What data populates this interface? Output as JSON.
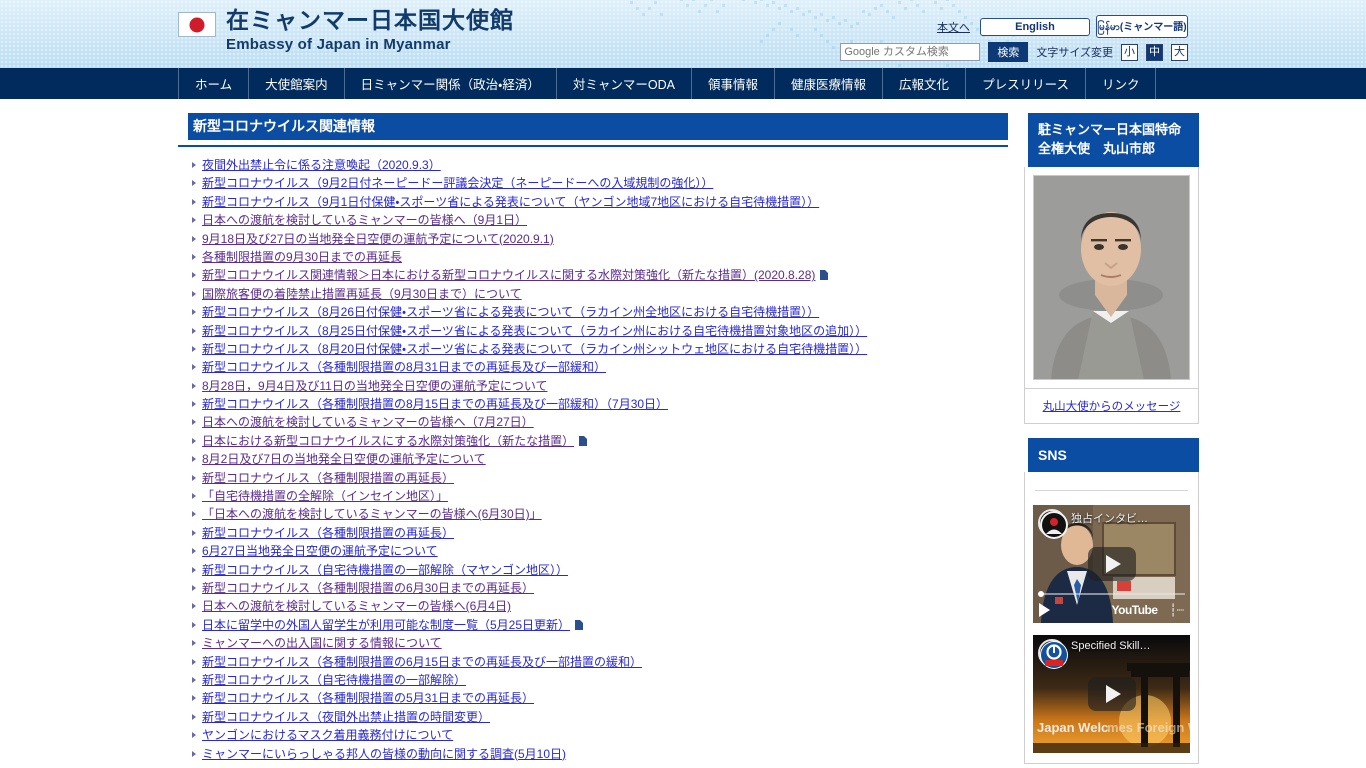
{
  "header": {
    "title_jp": "在ミャンマー日本国大使館",
    "title_en": "Embassy of Japan in Myanmar",
    "flag_icon": "japan-flag-icon",
    "skip_link": "本文へ",
    "lang_english": "English",
    "lang_myanmar": "မြန်မာ(ミャンマー語)",
    "search_placeholder": "Google カスタム検索",
    "search_value": "",
    "search_button": "検索",
    "fontsize_label": "文字サイズ変更",
    "fontsize_small": "小",
    "fontsize_medium": "中",
    "fontsize_large": "大",
    "fontsize_selected": "中",
    "accent_color": "#0b4da2",
    "nav_color": "#002b5c"
  },
  "nav": {
    "items": [
      {
        "label": "ホーム"
      },
      {
        "label": "大使館案内"
      },
      {
        "label": "日ミャンマー関係（政治・経済）"
      },
      {
        "label": "対ミャンマーODA"
      },
      {
        "label": "領事情報"
      },
      {
        "label": "健康医療情報"
      },
      {
        "label": "広報文化"
      },
      {
        "label": "プレスリリース"
      },
      {
        "label": "リンク"
      }
    ]
  },
  "main": {
    "section_title": "新型コロナウイルス関連情報",
    "links": [
      {
        "label": "夜間外出禁止令に係る注意喚起（2020.9.3）",
        "visited": false,
        "pdf": false
      },
      {
        "label": "新型コロナウイルス（9月2日付ネーピードー評議会決定（ネーピードーへの入域規制の強化））",
        "visited": false,
        "pdf": false
      },
      {
        "label": "新型コロナウイルス（9月1日付保健・スポーツ省による発表について（ヤンゴン地域7地区における自宅待機措置））",
        "visited": false,
        "pdf": false
      },
      {
        "label": "日本への渡航を検討しているミャンマーの皆様へ（9月1日）",
        "visited": true,
        "pdf": false
      },
      {
        "label": "9月18日及び27日の当地発全日空便の運航予定について(2020.9.1)",
        "visited": true,
        "pdf": false
      },
      {
        "label": "各種制限措置の9月30日までの再延長",
        "visited": true,
        "pdf": false
      },
      {
        "label": "新型コロナウイルス関連情報＞日本における新型コロナウイルスに関する水際対策強化（新たな措置）(2020.8.28)",
        "visited": true,
        "pdf": true
      },
      {
        "label": "国際旅客便の着陸禁止措置再延長（9月30日まで）について",
        "visited": true,
        "pdf": false
      },
      {
        "label": "新型コロナウイルス（8月26日付保健・スポーツ省による発表について（ラカイン州全地区における自宅待機措置））",
        "visited": false,
        "pdf": false
      },
      {
        "label": "新型コロナウイルス（8月25日付保健・スポーツ省による発表について（ラカイン州における自宅待機措置対象地区の追加））",
        "visited": false,
        "pdf": false
      },
      {
        "label": "新型コロナウイルス（8月20日付保健・スポーツ省による発表について（ラカイン州シットウェ地区における自宅待機措置））",
        "visited": false,
        "pdf": false
      },
      {
        "label": "新型コロナウイルス（各種制限措置の8月31日までの再延長及び一部緩和）",
        "visited": false,
        "pdf": false
      },
      {
        "label": "8月28日，9月4日及び11日の当地発全日空便の運航予定について",
        "visited": true,
        "pdf": false
      },
      {
        "label": "新型コロナウイルス（各種制限措置の8月15日までの再延長及び一部緩和）（7月30日）",
        "visited": false,
        "pdf": false
      },
      {
        "label": "日本への渡航を検討しているミャンマーの皆様へ（7月27日）",
        "visited": true,
        "pdf": false
      },
      {
        "label": "日本における新型コロナウイルスにする水際対策強化（新たな措置）",
        "visited": true,
        "pdf": true
      },
      {
        "label": "8月2日及び7日の当地発全日空便の運航予定について",
        "visited": true,
        "pdf": false
      },
      {
        "label": "新型コロナウイルス（各種制限措置の再延長）",
        "visited": true,
        "pdf": false
      },
      {
        "label": "「自宅待機措置の全解除（インセイン地区）」",
        "visited": true,
        "pdf": false
      },
      {
        "label": "「日本への渡航を検討しているミャンマーの皆様へ(6月30日)」",
        "visited": true,
        "pdf": false
      },
      {
        "label": "新型コロナウイルス（各種制限措置の再延長）",
        "visited": false,
        "pdf": false
      },
      {
        "label": "6月27日当地発全日空便の運航予定について",
        "visited": false,
        "pdf": false
      },
      {
        "label": "新型コロナウイルス（自宅待機措置の一部解除（マヤンゴン地区））",
        "visited": false,
        "pdf": false
      },
      {
        "label": "新型コロナウイルス（各種制限措置の6月30日までの再延長）",
        "visited": true,
        "pdf": false
      },
      {
        "label": "日本への渡航を検討しているミャンマーの皆様へ(6月4日)",
        "visited": true,
        "pdf": false
      },
      {
        "label": "日本に留学中の外国人留学生が利用可能な制度一覧（5月25日更新）",
        "visited": false,
        "pdf": true
      },
      {
        "label": "ミャンマーへの出入国に関する情報について",
        "visited": true,
        "pdf": false
      },
      {
        "label": "新型コロナウイルス（各種制限措置の6月15日までの再延長及び一部措置の緩和）",
        "visited": false,
        "pdf": false
      },
      {
        "label": "新型コロナウイルス（自宅待機措置の一部解除）",
        "visited": false,
        "pdf": false
      },
      {
        "label": "新型コロナウイルス（各種制限措置の5月31日までの再延長）",
        "visited": false,
        "pdf": false
      },
      {
        "label": "新型コロナウイルス（夜間外出禁止措置の時間変更）",
        "visited": false,
        "pdf": false
      },
      {
        "label": "ヤンゴンにおけるマスク着用義務付けについて",
        "visited": false,
        "pdf": false
      },
      {
        "label": "ミャンマーにいらっしゃる邦人の皆様の動向に関する調査(5月10日)",
        "visited": false,
        "pdf": false
      }
    ]
  },
  "sidebar": {
    "ambassador": {
      "title": "駐ミャンマー日本国特命全権大使　丸山市郎",
      "photo_name": "ambassador-portrait",
      "message_link": "丸山大使からのメッセージ"
    },
    "sns": {
      "title": "SNS",
      "videos": [
        {
          "title": "独占インタビ…",
          "avatar_icon": "japan-embassy-channel-icon",
          "play_icon": "play-button-icon",
          "brand": "YouTube",
          "fullscreen_icon": "fullscreen-icon"
        },
        {
          "title": "Specified Skill…",
          "avatar_icon": "mofa-channel-icon",
          "play_icon": "play-button-icon",
          "caption": "Japan Welcomes Foreign Workers"
        }
      ]
    }
  }
}
